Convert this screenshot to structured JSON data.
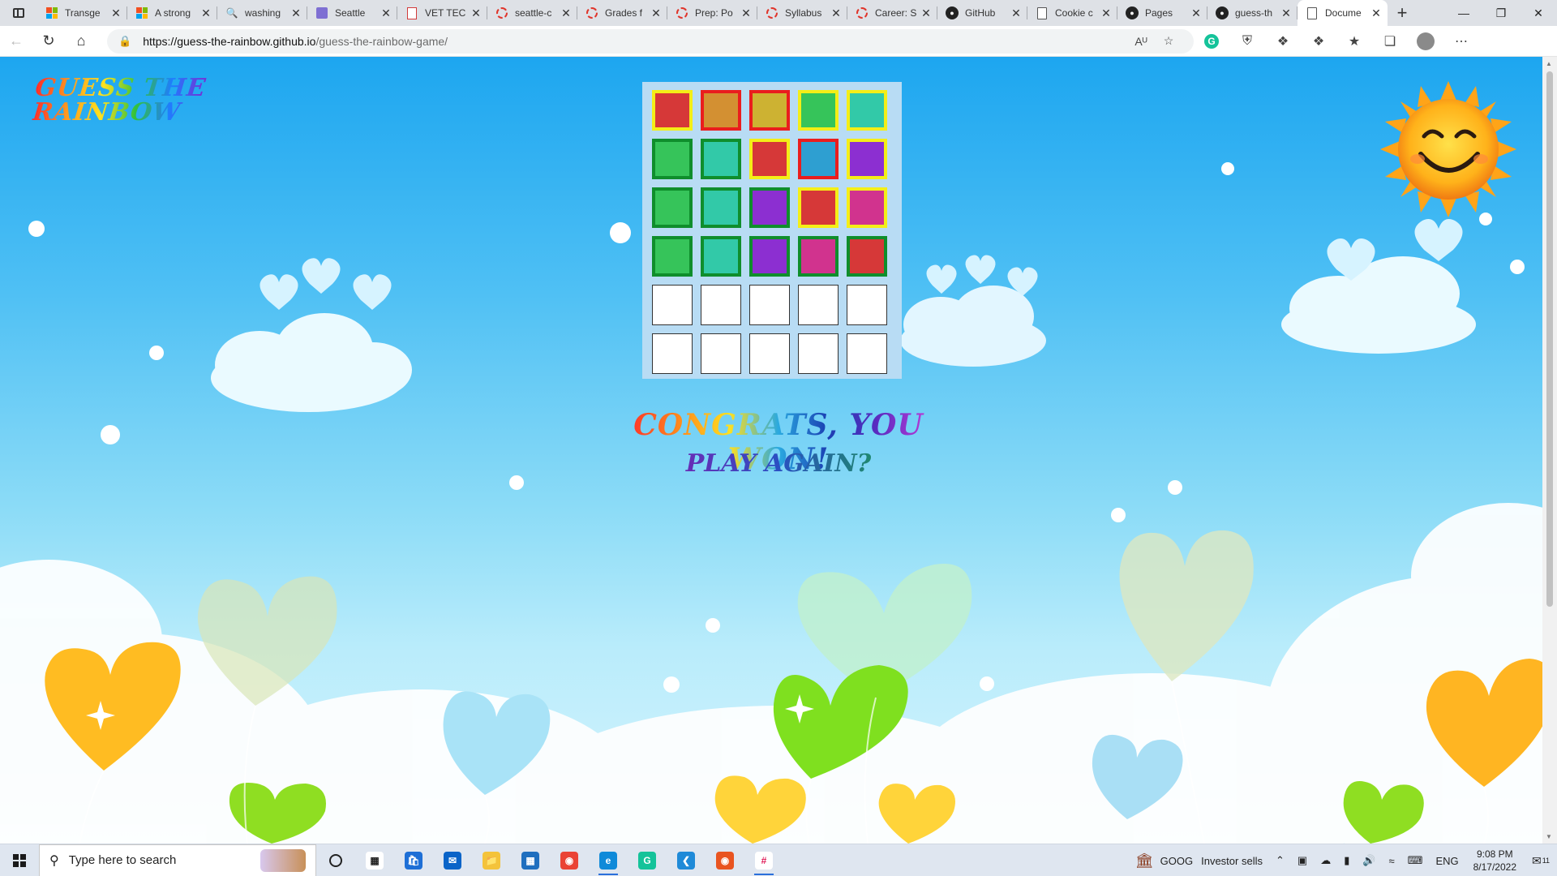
{
  "browser": {
    "tabs": [
      {
        "title": "Transge",
        "favicon": "microsoft-icon",
        "active": false
      },
      {
        "title": "A strong",
        "favicon": "microsoft-icon",
        "active": false
      },
      {
        "title": "washing",
        "favicon": "search-icon",
        "active": false
      },
      {
        "title": "Seattle",
        "favicon": "form-icon",
        "active": false
      },
      {
        "title": "VET TEC",
        "favicon": "pdf-icon",
        "active": false
      },
      {
        "title": "seattle-c",
        "favicon": "ring-icon",
        "active": false
      },
      {
        "title": "Grades f",
        "favicon": "ring-icon",
        "active": false
      },
      {
        "title": "Prep: Po",
        "favicon": "ring-icon",
        "active": false
      },
      {
        "title": "Syllabus",
        "favicon": "ring-icon",
        "active": false
      },
      {
        "title": "Career: S",
        "favicon": "ring-icon",
        "active": false
      },
      {
        "title": "GitHub",
        "favicon": "github-icon",
        "active": false
      },
      {
        "title": "Cookie c",
        "favicon": "document-icon",
        "active": false
      },
      {
        "title": "Pages",
        "favicon": "github-icon",
        "active": false
      },
      {
        "title": "guess-th",
        "favicon": "github-icon",
        "active": false
      },
      {
        "title": "Docume",
        "favicon": "document-icon",
        "active": true
      }
    ],
    "url_host": "https://guess-the-rainbow.github.io",
    "url_path": "/guess-the-rainbow-game/"
  },
  "game": {
    "logo_line1": "GUESS THE",
    "logo_line2": "RAINBOW",
    "result_title": "CONGRATS, YOU WON!",
    "play_again": "PLAY AGAIN?",
    "colors": {
      "red": "#d63838",
      "orange": "#d39032",
      "gold": "#cdb232",
      "green": "#36c45a",
      "teal": "#32c9a8",
      "blue": "#2e9fd1",
      "purple": "#8c2fd1",
      "pink": "#d1338e",
      "frame_yellow": "#f4ee17",
      "frame_red": "#ea1d1d",
      "frame_green": "#0f8e2c"
    },
    "board": [
      [
        {
          "fill": "red",
          "frame": "frame_yellow"
        },
        {
          "fill": "orange",
          "frame": "frame_red"
        },
        {
          "fill": "gold",
          "frame": "frame_red"
        },
        {
          "fill": "green",
          "frame": "frame_yellow"
        },
        {
          "fill": "teal",
          "frame": "frame_yellow"
        }
      ],
      [
        {
          "fill": "green",
          "frame": "frame_green"
        },
        {
          "fill": "teal",
          "frame": "frame_green"
        },
        {
          "fill": "red",
          "frame": "frame_yellow"
        },
        {
          "fill": "blue",
          "frame": "frame_red"
        },
        {
          "fill": "purple",
          "frame": "frame_yellow"
        }
      ],
      [
        {
          "fill": "green",
          "frame": "frame_green"
        },
        {
          "fill": "teal",
          "frame": "frame_green"
        },
        {
          "fill": "purple",
          "frame": "frame_green"
        },
        {
          "fill": "red",
          "frame": "frame_yellow"
        },
        {
          "fill": "pink",
          "frame": "frame_yellow"
        }
      ],
      [
        {
          "fill": "green",
          "frame": "frame_green"
        },
        {
          "fill": "teal",
          "frame": "frame_green"
        },
        {
          "fill": "purple",
          "frame": "frame_green"
        },
        {
          "fill": "pink",
          "frame": "frame_green"
        },
        {
          "fill": "red",
          "frame": "frame_green"
        }
      ],
      [
        null,
        null,
        null,
        null,
        null
      ],
      [
        null,
        null,
        null,
        null,
        null
      ]
    ]
  },
  "taskbar": {
    "search_placeholder": "Type here to search",
    "apps": [
      "task-view-icon",
      "store-icon",
      "mail-icon",
      "file-explorer-icon",
      "calendar-icon",
      "chrome-icon",
      "edge-icon",
      "grammarly-icon",
      "vscode-icon",
      "ubuntu-icon",
      "slack-icon"
    ],
    "ticker_symbol": "GOOG",
    "ticker_text": "Investor sells",
    "language": "ENG",
    "time": "9:08 PM",
    "date": "8/17/2022",
    "notification_count": "11"
  }
}
